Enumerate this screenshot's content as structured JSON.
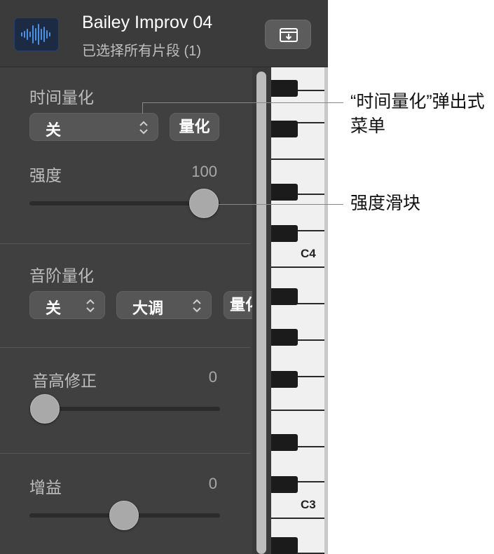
{
  "header": {
    "region_name": "Bailey Improv 04",
    "selection_status": "已选择所有片段 (1)"
  },
  "time_quantize": {
    "label": "时间量化",
    "popup_value": "关",
    "quantize_button": "量化"
  },
  "strength": {
    "label": "强度",
    "value": "100",
    "slider_fraction": 1.0
  },
  "scale_quantize": {
    "label": "音阶量化",
    "root_value": "关",
    "scale_value": "大调",
    "quantize_button": "量化"
  },
  "pitch_correction": {
    "label": "音高修正",
    "value": "0",
    "slider_fraction": 0.0
  },
  "gain": {
    "label": "增益",
    "value": "0",
    "slider_fraction": 0.5
  },
  "piano": {
    "labels": [
      "C4",
      "C3"
    ]
  },
  "callouts": {
    "time_quantize_popup": "“时间量化”弹出式菜单",
    "strength_slider": "强度滑块"
  },
  "colors": {
    "panel_bg": "#404040",
    "header_bg": "#3b3b3b",
    "thumb_bg": "#1c2a43",
    "waveform": "#4a90e2"
  }
}
